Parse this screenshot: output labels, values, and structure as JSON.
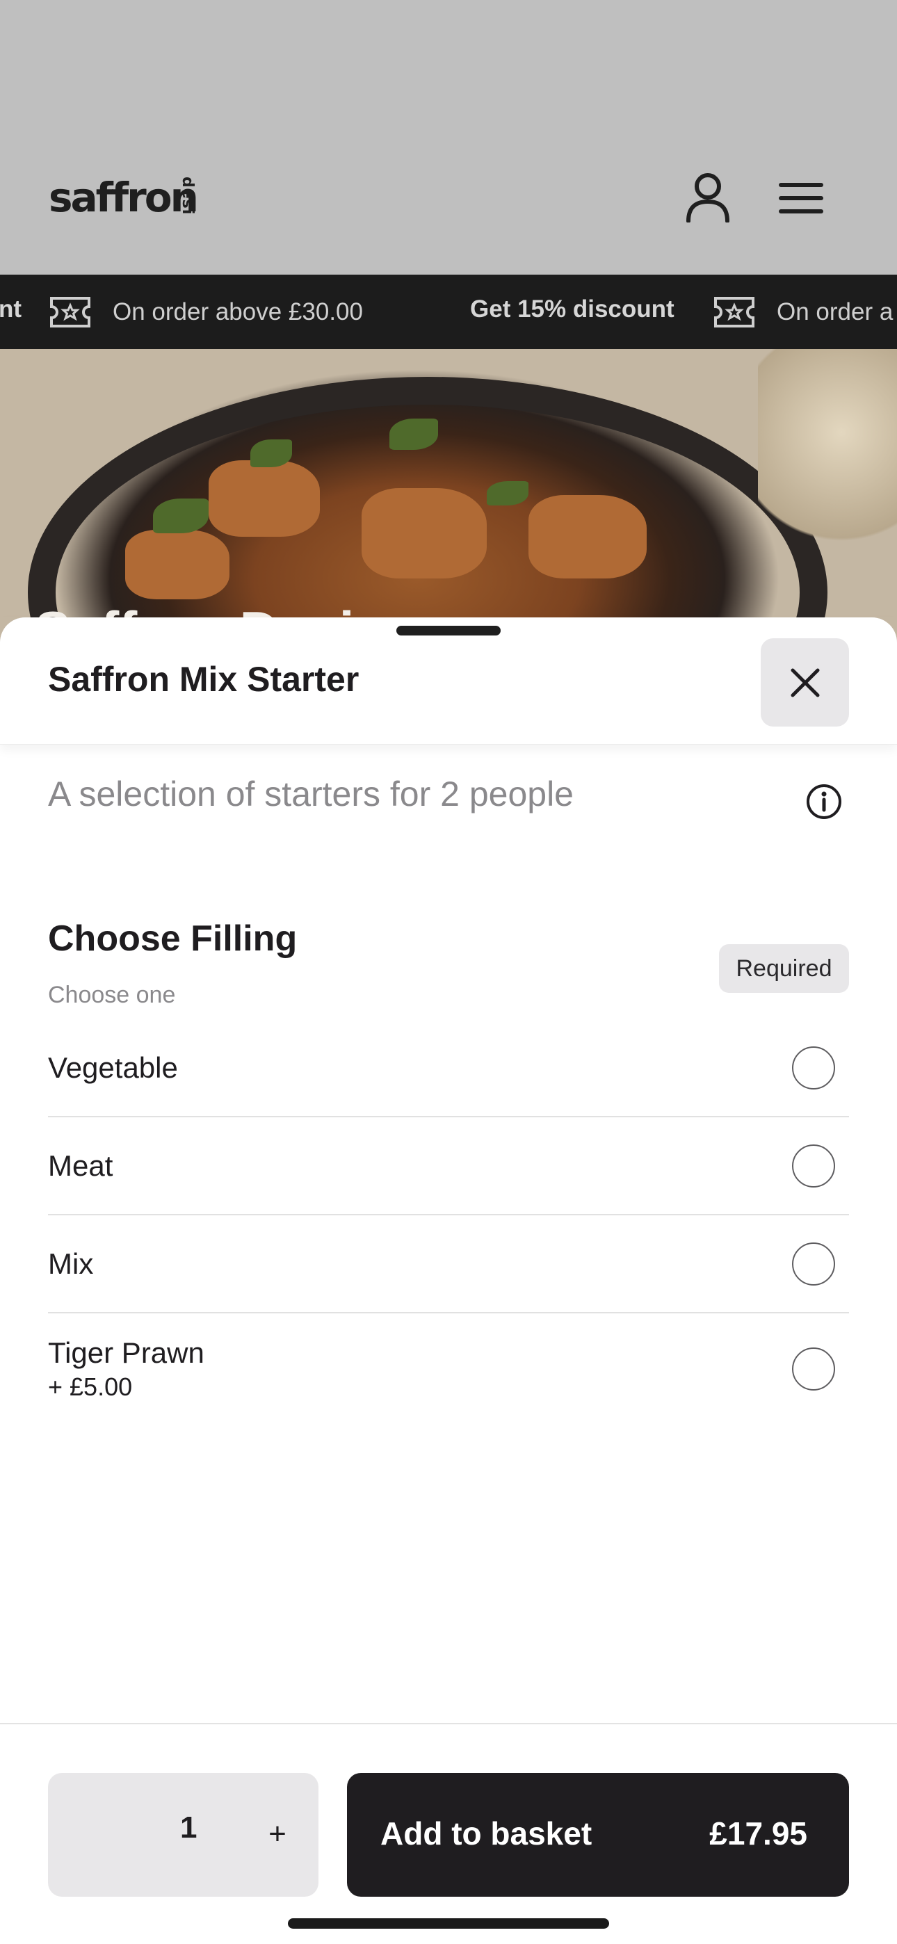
{
  "header": {
    "logo_text": "saffron",
    "logo_suffix": "desi",
    "account_icon": "user-icon",
    "menu_icon": "hamburger-menu-icon"
  },
  "promo": {
    "items": [
      {
        "bold": "nt",
        "text": ""
      },
      {
        "icon": "ticket-icon",
        "text": "On order above £30.00"
      },
      {
        "bold": "Get 15% discount",
        "text": ""
      },
      {
        "icon": "ticket-icon",
        "text": "On order a"
      }
    ]
  },
  "hero": {
    "title_partial": "Saffron Desi"
  },
  "sheet": {
    "title": "Saffron Mix Starter",
    "description": "A selection of starters for 2 people",
    "group": {
      "title": "Choose Filling",
      "subtitle": "Choose one",
      "badge": "Required",
      "options": [
        {
          "label": "Vegetable",
          "price": ""
        },
        {
          "label": "Meat",
          "price": ""
        },
        {
          "label": "Mix",
          "price": ""
        },
        {
          "label": "Tiger Prawn",
          "price": "+ £5.00"
        }
      ]
    }
  },
  "footer": {
    "quantity": "1",
    "plus": "+",
    "add_label": "Add to basket",
    "total": "£17.95"
  },
  "colors": {
    "dark": "#1f1d20",
    "muted": "#8a898c",
    "chip_bg": "#e8e7e9",
    "overlay": "#bfbfbf"
  }
}
